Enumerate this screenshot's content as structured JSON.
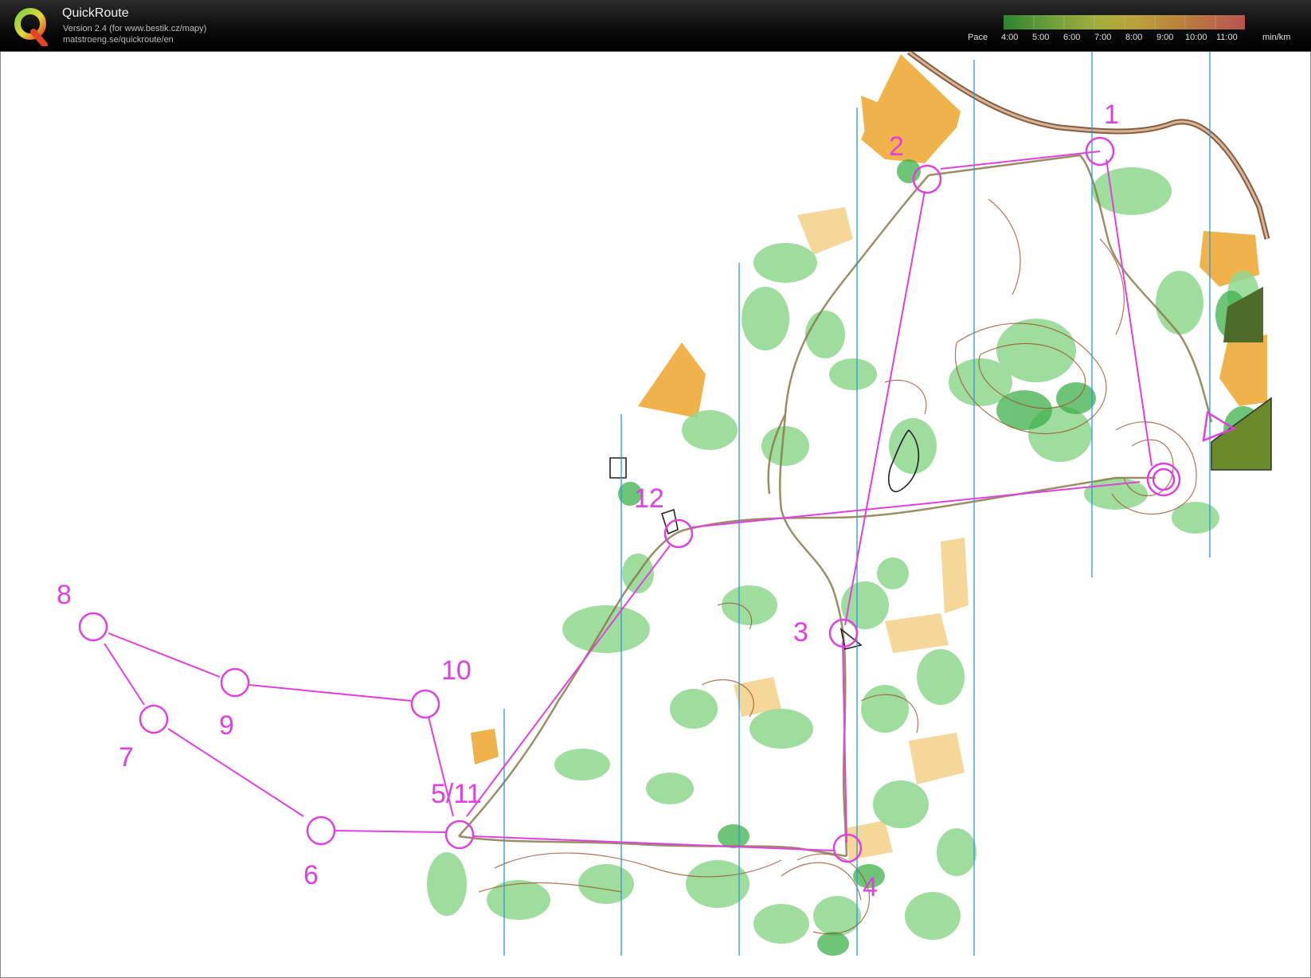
{
  "header": {
    "app_name": "QuickRoute",
    "version": "Version 2.4  (for www.bestik.cz/mapy)",
    "site": "matstroeng.se/quickroute/en"
  },
  "pace_legend": {
    "title": "Pace",
    "ticks": [
      "4:00",
      "5:00",
      "6:00",
      "7:00",
      "8:00",
      "9:00",
      "10:00",
      "11:00"
    ],
    "unit": "min/km"
  },
  "course": {
    "color": "#e040e0",
    "control_labels": [
      "1",
      "2",
      "3",
      "4",
      "5/11",
      "6",
      "7",
      "8",
      "9",
      "10",
      "12"
    ]
  }
}
